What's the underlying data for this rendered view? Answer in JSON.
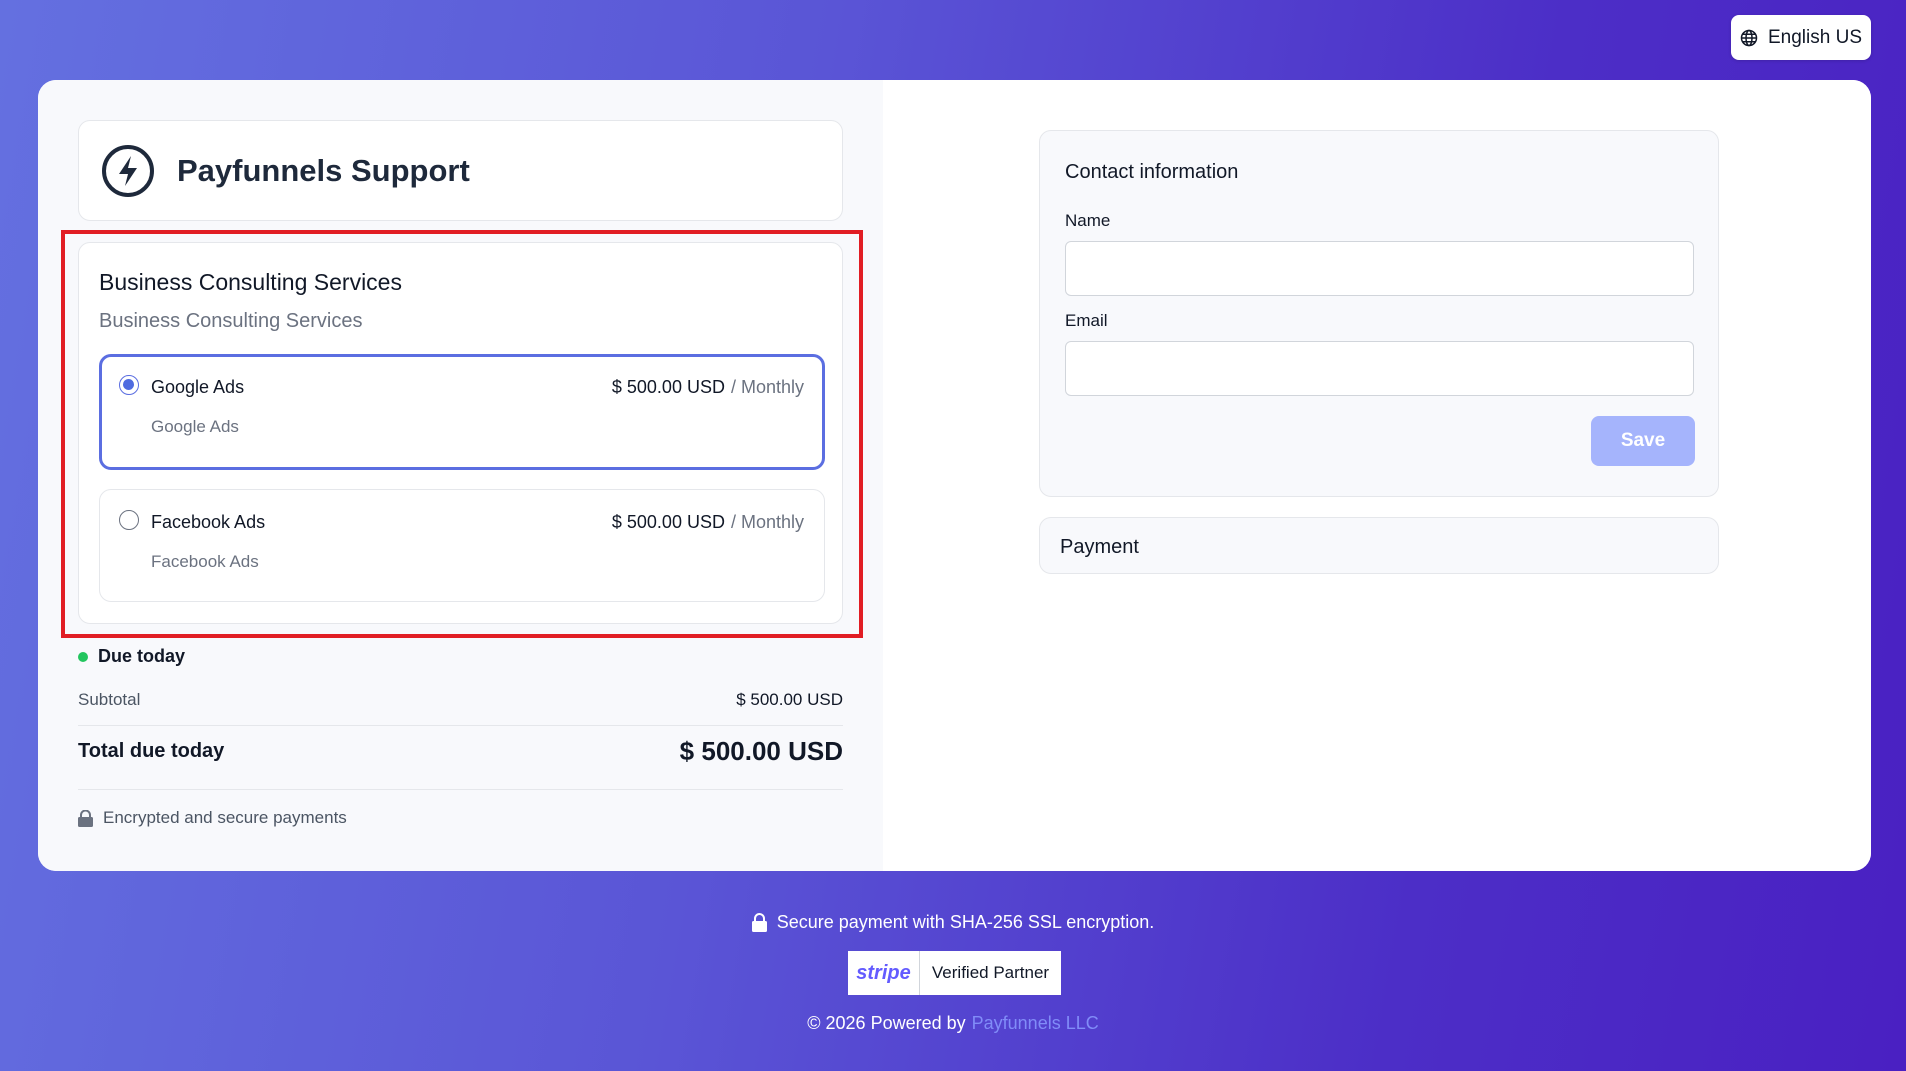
{
  "language": {
    "label": "English US",
    "icon": "globe-icon"
  },
  "brand": {
    "title": "Payfunnels Support",
    "icon": "lightning-bolt-icon"
  },
  "product": {
    "title": "Business Consulting Services",
    "subtitle": "Business Consulting Services",
    "options": [
      {
        "name": "Google Ads",
        "description": "Google Ads",
        "price": "$ 500.00 USD",
        "period": "/ Monthly",
        "selected": true
      },
      {
        "name": "Facebook Ads",
        "description": "Facebook Ads",
        "price": "$ 500.00 USD",
        "period": "/ Monthly",
        "selected": false
      }
    ]
  },
  "summary": {
    "due_today_label": "Due today",
    "subtotal_label": "Subtotal",
    "subtotal_value": "$ 500.00 USD",
    "total_label": "Total due today",
    "total_value": "$ 500.00 USD",
    "secure_note": "Encrypted and secure payments"
  },
  "contact": {
    "title": "Contact information",
    "name_label": "Name",
    "name_value": "",
    "email_label": "Email",
    "email_value": "",
    "save_label": "Save"
  },
  "payment": {
    "title": "Payment"
  },
  "footer": {
    "secure_text": "Secure payment with SHA-256 SSL encryption.",
    "stripe_logo": "stripe",
    "stripe_badge": "Verified Partner",
    "powered_text": "© 2026 Powered by",
    "powered_link": "Payfunnels LLC"
  },
  "colors": {
    "accent": "#5b6ee1",
    "highlight_border": "#e11d24",
    "status_dot": "#22c55e",
    "save_button": "#a5b4fc",
    "link": "#818cf8"
  }
}
